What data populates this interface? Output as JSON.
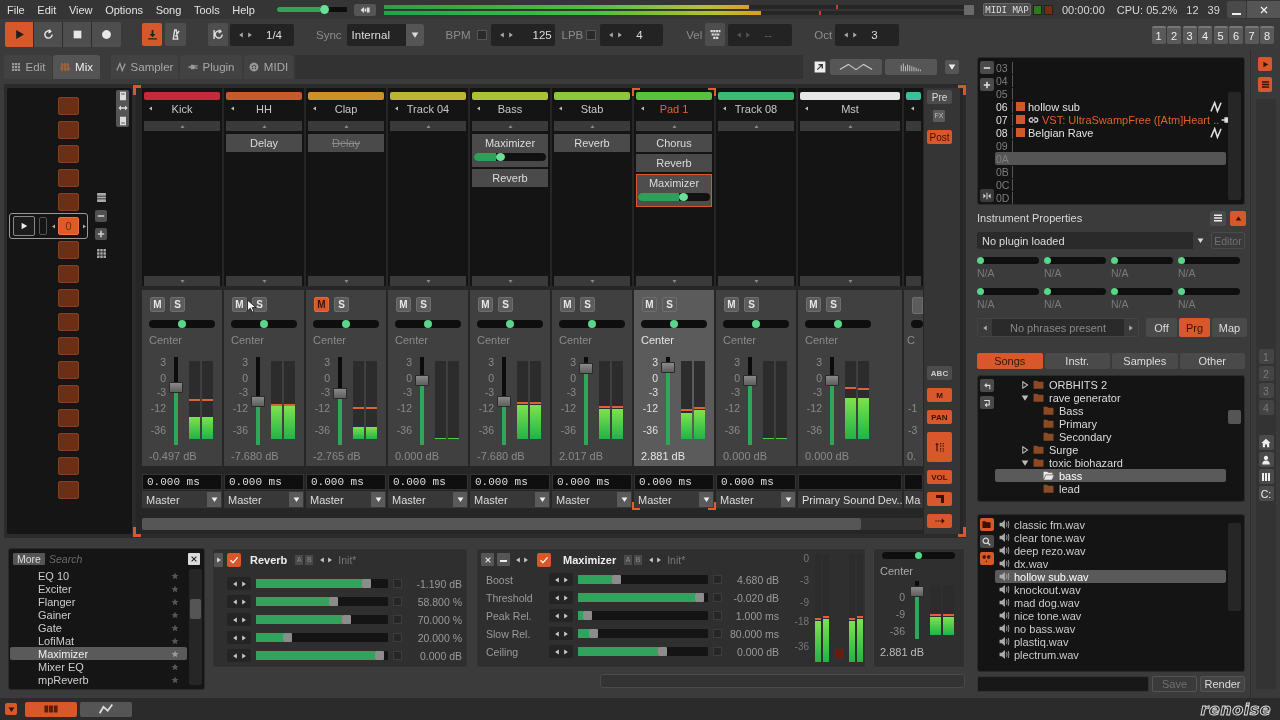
{
  "menu": [
    "File",
    "Edit",
    "View",
    "Options",
    "Song",
    "Tools",
    "Help"
  ],
  "top_bar": {
    "master_volume": {
      "level": 0.7
    },
    "output_meters": [
      {
        "level": 0.63,
        "peak": {
          "level": 0.78
        }
      },
      {
        "level": 0.65,
        "peak": {
          "level": 0.75
        }
      }
    ],
    "midi_map": "MIDI MAP",
    "midi_indicators": [
      {
        "color": "#2e7a1e"
      },
      {
        "color": "#7a2c12"
      }
    ],
    "time": "00:00:00",
    "cpu": "CPU: 05.2%",
    "clock": [
      "12",
      "39"
    ]
  },
  "toolbar": {
    "transport": [
      {
        "kind": "play",
        "on": true
      },
      {
        "kind": "loop",
        "on": false
      },
      {
        "kind": "stop",
        "on": false
      },
      {
        "kind": "record",
        "on": false
      }
    ],
    "follow": {
      "on": true
    },
    "metronome": {
      "on": false
    },
    "block_loop": {
      "on": false,
      "value": "1/4"
    },
    "sync": {
      "label": "Sync",
      "value": "Internal"
    },
    "bpm": {
      "label": "BPM",
      "checked": false,
      "value": "125"
    },
    "lpb": {
      "label": "LPB",
      "checked": false,
      "value": "4"
    },
    "velocity": {
      "label": "Vel",
      "value": "--",
      "disabled": true
    },
    "octave": {
      "label": "Oct",
      "value": "3"
    },
    "track_buttons": [
      "1",
      "2",
      "3",
      "4",
      "5",
      "6",
      "7",
      "8"
    ]
  },
  "tabs": [
    {
      "label": "Edit",
      "selected": false
    },
    {
      "label": "Mix",
      "selected": true
    },
    {
      "label": "Sampler",
      "selected": false
    },
    {
      "label": "Plugin",
      "selected": false
    },
    {
      "label": "MIDI",
      "selected": false
    }
  ],
  "pattern_sequence": {
    "current": "0",
    "slots": [
      {
        "selected": false
      },
      {
        "selected": false
      },
      {
        "selected": false
      },
      {
        "selected": false
      },
      {
        "selected": false
      },
      {
        "selected": true
      },
      {
        "selected": false
      },
      {
        "selected": false
      },
      {
        "selected": false
      },
      {
        "selected": false
      },
      {
        "selected": false
      },
      {
        "selected": false
      },
      {
        "selected": false
      },
      {
        "selected": false
      },
      {
        "selected": false
      },
      {
        "selected": false
      },
      {
        "selected": false
      }
    ]
  },
  "mixer": {
    "tracks": [
      {
        "kind": "track",
        "name": "Kick",
        "color": "#c52a3a",
        "selected": false,
        "mute": {
          "label": "M",
          "on": false
        },
        "solo": {
          "label": "S",
          "on": false
        },
        "pan": {
          "level": 0.5
        },
        "pan_label": "Center",
        "scale": [
          "3",
          "0",
          "-3",
          "-12",
          "-36"
        ],
        "volume": {
          "level": 0.68
        },
        "meters": [
          {
            "level": 0.28,
            "peak": {
              "level": 0.5
            }
          },
          {
            "level": 0.28,
            "peak": {
              "level": 0.5
            }
          }
        ],
        "volume_reading": "-0.497 dB",
        "delay": "0.000 ms",
        "output": "Master"
      },
      {
        "kind": "track",
        "name": "HH",
        "color": "#c65a2c",
        "selected": false,
        "devices": [
          {
            "kind": "plain",
            "name": "Delay",
            "bypassed": false,
            "selected": false
          }
        ],
        "mute": {
          "label": "M",
          "on": false
        },
        "solo": {
          "label": "S",
          "on": false
        },
        "pan": {
          "level": 0.5
        },
        "pan_label": "Center",
        "scale": [
          "3",
          "0",
          "-3",
          "-12",
          "-36"
        ],
        "volume": {
          "level": 0.49
        },
        "meters": [
          {
            "level": 0.42,
            "peak": {
              "level": 0.44
            }
          },
          {
            "level": 0.42,
            "peak": {
              "level": 0.44
            }
          }
        ],
        "volume_reading": "-7.680 dB",
        "delay": "0.000 ms",
        "output": "Master"
      },
      {
        "kind": "track",
        "name": "Clap",
        "color": "#c9922a",
        "selected": false,
        "devices": [
          {
            "kind": "plain",
            "name": "Delay",
            "bypassed": true,
            "selected": false
          }
        ],
        "mute": {
          "label": "M",
          "on": true
        },
        "solo": {
          "label": "S",
          "on": false
        },
        "pan": {
          "level": 0.5
        },
        "pan_label": "Center",
        "scale": [
          "3",
          "0",
          "-3",
          "-12",
          "-36"
        ],
        "volume": {
          "level": 0.6
        },
        "meters": [
          {
            "level": 0.15,
            "peak": {
              "level": 0.4
            }
          },
          {
            "level": 0.15,
            "peak": {
              "level": 0.4
            }
          }
        ],
        "volume_reading": "-2.765 dB",
        "delay": "0.000 ms",
        "output": "Master"
      },
      {
        "kind": "track",
        "name": "Track 04",
        "color": "#bdb534",
        "selected": false,
        "mute": {
          "label": "M",
          "on": false
        },
        "solo": {
          "label": "S",
          "on": false
        },
        "pan": {
          "level": 0.5
        },
        "pan_label": "Center",
        "scale": [
          "3",
          "0",
          "-3",
          "-12",
          "-36"
        ],
        "volume": {
          "level": 0.76
        },
        "meters": [
          {
            "level": 0
          },
          {
            "level": 0
          }
        ],
        "volume_reading": "0.000 dB",
        "delay": "0.000 ms",
        "output": "Master"
      },
      {
        "kind": "track",
        "name": "Bass",
        "color": "#a9c236",
        "selected": false,
        "devices": [
          {
            "kind": "slider",
            "name": "Maximizer",
            "bypassed": false,
            "selected": false,
            "slider": {
              "level": 0.35
            }
          },
          {
            "kind": "plain",
            "name": "Reverb",
            "bypassed": false,
            "selected": false
          }
        ],
        "mute": {
          "label": "M",
          "on": false
        },
        "solo": {
          "label": "S",
          "on": false
        },
        "pan": {
          "level": 0.5
        },
        "pan_label": "Center",
        "scale": [
          "3",
          "0",
          "-3",
          "-12",
          "-36"
        ],
        "volume": {
          "level": 0.49
        },
        "meters": [
          {
            "level": 0.43,
            "peak": {
              "level": 0.46
            }
          },
          {
            "level": 0.43,
            "peak": {
              "level": 0.46
            }
          }
        ],
        "volume_reading": "-7.680 dB",
        "delay": "0.000 ms",
        "output": "Master"
      },
      {
        "kind": "track",
        "name": "Stab",
        "color": "#8cc63c",
        "selected": false,
        "devices": [
          {
            "kind": "plain",
            "name": "Reverb",
            "bypassed": false,
            "selected": false
          }
        ],
        "mute": {
          "label": "M",
          "on": false
        },
        "solo": {
          "label": "S",
          "on": false
        },
        "pan": {
          "level": 0.5
        },
        "pan_label": "Center",
        "scale": [
          "3",
          "0",
          "-3",
          "-12",
          "-36"
        ],
        "volume": {
          "level": 0.92
        },
        "meters": [
          {
            "level": 0.38,
            "peak": {
              "level": 0.41
            }
          },
          {
            "level": 0.38,
            "peak": {
              "level": 0.41
            }
          }
        ],
        "volume_reading": "2.017 dB",
        "delay": "0.000 ms",
        "output": "Master"
      },
      {
        "kind": "track",
        "name": "Pad 1",
        "color": "#58c23c",
        "selected": true,
        "devices": [
          {
            "kind": "plain",
            "name": "Chorus",
            "bypassed": false,
            "selected": false
          },
          {
            "kind": "plain",
            "name": "Reverb",
            "bypassed": false,
            "selected": false
          },
          {
            "kind": "slider",
            "name": "Maximizer",
            "bypassed": false,
            "selected": true,
            "slider": {
              "level": 0.65
            }
          }
        ],
        "mute": {
          "label": "M",
          "on": false
        },
        "solo": {
          "label": "S",
          "on": false
        },
        "pan": {
          "level": 0.5
        },
        "pan_label": "Center",
        "scale": [
          "3",
          "0",
          "-3",
          "-12",
          "-36"
        ],
        "volume": {
          "level": 0.94
        },
        "meters": [
          {
            "level": 0.33,
            "peak": {
              "level": 0.37
            }
          },
          {
            "level": 0.37,
            "peak": {
              "level": 0.4
            }
          }
        ],
        "volume_reading": "2.881 dB",
        "delay": "0.000 ms",
        "output": "Master"
      },
      {
        "kind": "track",
        "name": "Track 08",
        "color": "#3cba74",
        "selected": false,
        "mute": {
          "label": "M",
          "on": false
        },
        "solo": {
          "label": "S",
          "on": false
        },
        "pan": {
          "level": 0.5
        },
        "pan_label": "Center",
        "scale": [
          "3",
          "0",
          "-3",
          "-12",
          "-36"
        ],
        "volume": {
          "level": 0.76
        },
        "meters": [
          {
            "level": 0
          },
          {
            "level": 0
          }
        ],
        "volume_reading": "0.000 dB",
        "delay": "0.000 ms",
        "output": "Master"
      },
      {
        "kind": "master",
        "name": "Mst",
        "color": "#e6e6e6",
        "selected": false,
        "mute": {
          "label": "M",
          "on": false
        },
        "solo": {
          "label": "S",
          "on": false
        },
        "pan": {
          "level": 0.5
        },
        "pan_label": "Center",
        "scale": [
          "3",
          "0",
          "-3",
          "-12",
          "-36"
        ],
        "volume": {
          "level": 0.76
        },
        "meters": [
          {
            "level": 0.53,
            "peak": {
              "level": 0.66
            }
          },
          {
            "level": 0.53,
            "peak": {
              "level": 0.64
            }
          }
        ],
        "volume_reading": "0.000 dB",
        "output": "Primary Sound Dev.."
      }
    ],
    "partial_track": {
      "color": "#3cbf9c",
      "pan_label": "C",
      "scale": [
        "-1",
        "-3"
      ],
      "volume_reading": "0.",
      "output": "Ma"
    },
    "fx_position": [
      {
        "label": "Pre",
        "selected": false
      },
      {
        "label": "Post",
        "selected": true
      }
    ],
    "fx_label": "FX",
    "strip_toggles": [
      {
        "kind": "text",
        "label": "ABC",
        "on": false
      },
      {
        "kind": "text",
        "label": "M",
        "on": true
      },
      {
        "kind": "text",
        "label": "PAN",
        "on": true
      },
      {
        "kind": "bars",
        "on": true
      },
      {
        "kind": "text",
        "label": "VOL",
        "on": true
      },
      {
        "kind": "block",
        "on": true
      },
      {
        "kind": "arrow",
        "on": true
      }
    ]
  },
  "dsp_browser": {
    "more": "More",
    "search": {
      "placeholder": "Search"
    },
    "items": [
      {
        "name": "EQ 10",
        "selected": false
      },
      {
        "name": "Exciter",
        "selected": false
      },
      {
        "name": "Flanger",
        "selected": false
      },
      {
        "name": "Gainer",
        "selected": false
      },
      {
        "name": "Gate",
        "selected": false
      },
      {
        "name": "LofiMat",
        "selected": false
      },
      {
        "name": "Maximizer",
        "selected": true
      },
      {
        "name": "Mixer EQ",
        "selected": false
      },
      {
        "name": "mpReverb",
        "selected": false
      }
    ]
  },
  "reverb_device": {
    "name": "Reverb",
    "enabled": true,
    "ab": [
      "A",
      "B"
    ],
    "preset": "Init*",
    "params": [
      {
        "level": 0.86,
        "checked": false,
        "value": "-1.190 dB"
      },
      {
        "level": 0.59,
        "checked": false,
        "value": "58.800 %"
      },
      {
        "level": 0.7,
        "checked": false,
        "value": "70.000 %"
      },
      {
        "level": 0.22,
        "checked": false,
        "value": "20.000 %"
      },
      {
        "level": 0.97,
        "checked": false,
        "value": "0.000 dB"
      }
    ]
  },
  "maximizer_device": {
    "name": "Maximizer",
    "enabled": true,
    "ab": [
      "A",
      "B"
    ],
    "preset": "Init*",
    "params": [
      {
        "label": "Boost",
        "level": 0.28,
        "checked": false,
        "value": "4.680 dB"
      },
      {
        "label": "Threshold",
        "level": 0.97,
        "checked": false,
        "value": "-0.020 dB"
      },
      {
        "label": "Peak Rel.",
        "level": 0.04,
        "checked": false,
        "value": "1.000 ms"
      },
      {
        "label": "Slow Rel.",
        "level": 0.09,
        "checked": false,
        "value": "80.000 ms"
      },
      {
        "label": "Ceiling",
        "level": 0.66,
        "checked": false,
        "value": "0.000 dB"
      }
    ],
    "meter_scale": [
      "0",
      "-3",
      "-9",
      "-18",
      "-36"
    ],
    "meters": [
      {
        "level": 0.38,
        "peak": {
          "level": 0.4
        }
      },
      {
        "level": 0.4,
        "peak": {
          "level": 0.42
        }
      },
      {
        "level": 0.38,
        "peak": {
          "level": 0.4
        }
      },
      {
        "level": 0.4,
        "peak": {
          "level": 0.42
        }
      }
    ]
  },
  "track_panel": {
    "pan": {
      "level": 0.5
    },
    "pan_label": "Center",
    "scale": [
      "0",
      "-9",
      "-36"
    ],
    "volume": {
      "level": 0.9
    },
    "meters": [
      {
        "level": 0.36,
        "peak": {
          "level": 0.4
        }
      },
      {
        "level": 0.36,
        "peak": {
          "level": 0.4
        }
      }
    ],
    "volume_reading": "2.881 dB"
  },
  "instruments": {
    "rows": [
      {
        "index": "03",
        "kind": "empty",
        "selected": false
      },
      {
        "index": "04",
        "kind": "empty",
        "selected": false
      },
      {
        "index": "05",
        "kind": "empty",
        "selected": false
      },
      {
        "index": "06",
        "kind": "sample",
        "name": "hollow sub",
        "selected": false
      },
      {
        "index": "07",
        "kind": "plugin",
        "name": "VST: UltraSwampFree ([Atm]Heart ..",
        "selected": false
      },
      {
        "index": "08",
        "kind": "sample",
        "name": "Belgian Rave",
        "selected": false
      },
      {
        "index": "09",
        "kind": "empty",
        "selected": false
      },
      {
        "index": "0A",
        "kind": "empty",
        "selected": true
      },
      {
        "index": "0B",
        "kind": "empty",
        "selected": false
      },
      {
        "index": "0C",
        "kind": "empty",
        "selected": false
      },
      {
        "index": "0D",
        "kind": "empty",
        "selected": false
      }
    ]
  },
  "instrument_properties": {
    "title": "Instrument Properties",
    "plugin": {
      "value": "No plugin loaded"
    },
    "editor": {
      "label": "Editor",
      "disabled": true
    },
    "macros": [
      {
        "level": 0,
        "label": "N/A"
      },
      {
        "level": 0,
        "label": "N/A"
      },
      {
        "level": 0,
        "label": "N/A"
      },
      {
        "level": 0,
        "label": "N/A"
      },
      {
        "level": 0,
        "label": "N/A"
      },
      {
        "level": 0,
        "label": "N/A"
      },
      {
        "level": 0,
        "label": "N/A"
      },
      {
        "level": 0,
        "label": "N/A"
      }
    ],
    "phrases": {
      "value": "No phrases present"
    },
    "modes": [
      {
        "label": "Off",
        "selected": false
      },
      {
        "label": "Prg",
        "selected": true
      },
      {
        "label": "Map",
        "selected": false
      }
    ]
  },
  "browser": {
    "tabs": [
      {
        "label": "Songs",
        "selected": true
      },
      {
        "label": "Instr.",
        "selected": false
      },
      {
        "label": "Samples",
        "selected": false
      },
      {
        "label": "Other",
        "selected": false
      }
    ],
    "tree": [
      {
        "name": "ORBHITS 2",
        "expanded": false,
        "selected": false
      },
      {
        "name": "rave generator",
        "expanded": true,
        "selected": false,
        "children": [
          {
            "name": "Bass",
            "selected": false
          },
          {
            "name": "Primary",
            "selected": false
          },
          {
            "name": "Secondary",
            "selected": false
          }
        ]
      },
      {
        "name": "Surge",
        "expanded": false,
        "selected": false
      },
      {
        "name": "toxic biohazard",
        "expanded": true,
        "selected": false,
        "children": [
          {
            "name": "bass",
            "selected": true
          },
          {
            "name": "lead",
            "selected": false
          }
        ]
      }
    ],
    "files": [
      {
        "name": "classic fm.wav",
        "selected": false
      },
      {
        "name": "clear tone.wav",
        "selected": false
      },
      {
        "name": "deep rezo.wav",
        "selected": false
      },
      {
        "name": "dx.wav",
        "selected": false
      },
      {
        "name": "hollow sub.wav",
        "selected": true
      },
      {
        "name": "knockout.wav",
        "selected": false
      },
      {
        "name": "mad dog.wav",
        "selected": false
      },
      {
        "name": "nice tone.wav",
        "selected": false
      },
      {
        "name": "no bass.wav",
        "selected": false
      },
      {
        "name": "plastiq.wav",
        "selected": false
      },
      {
        "name": "plectrum.wav",
        "selected": false
      }
    ],
    "save": {
      "label": "Save",
      "disabled": true
    },
    "render": {
      "label": "Render"
    }
  },
  "side_panel": {
    "pages": [
      {
        "label": "1",
        "disabled": true
      },
      {
        "label": "2",
        "disabled": true
      },
      {
        "label": "3",
        "disabled": true
      },
      {
        "label": "4",
        "disabled": true
      }
    ],
    "drive": "C:"
  },
  "status_bar": {
    "views": [
      {
        "kind": "matrix",
        "selected": true
      },
      {
        "kind": "automation",
        "selected": false
      }
    ],
    "logo": "renoise"
  }
}
